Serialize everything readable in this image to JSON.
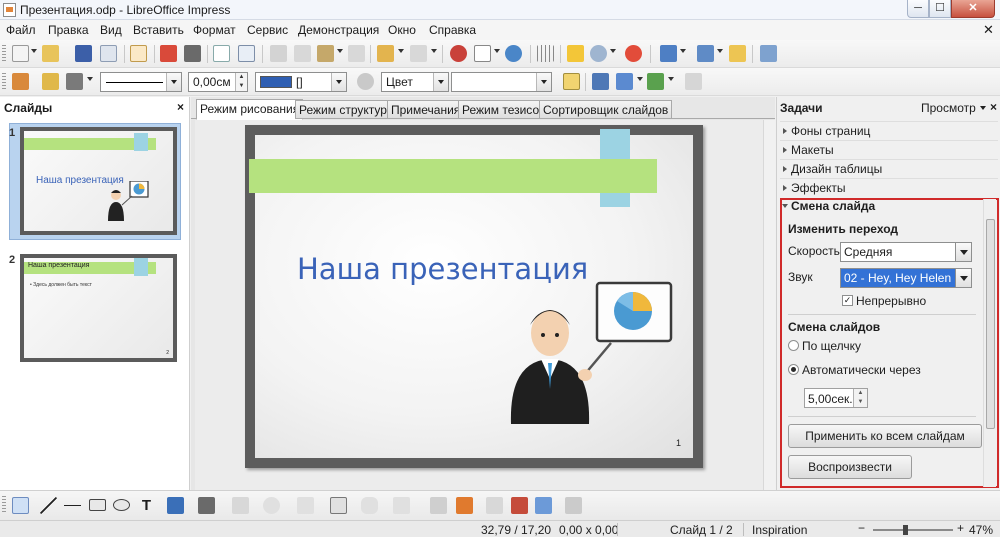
{
  "window": {
    "title": "Презентация.odp - LibreOffice Impress",
    "min": "─",
    "max": "☐",
    "close": "✕"
  },
  "menu": [
    "Файл",
    "Правка",
    "Вид",
    "Вставить",
    "Формат",
    "Сервис",
    "Демонстрация",
    "Окно",
    "Справка"
  ],
  "format_bar": {
    "line_width": "0,00см",
    "area_style": "Цвет",
    "line_color_swatch": "#2f5fb3",
    "line_color_name": "[]"
  },
  "slides_panel": {
    "title": "Слайды",
    "slides": [
      {
        "number": "1",
        "title": "Наша презентация",
        "selected": true
      },
      {
        "number": "2",
        "title": "Наша презентация",
        "bullet": "• Здесь должен быть текст",
        "selected": false
      }
    ]
  },
  "view_tabs": [
    "Режим рисования",
    "Режим структуры",
    "Примечания",
    "Режим тезисов",
    "Сортировщик слайдов"
  ],
  "slide": {
    "title": "Наша презентация",
    "number": "1"
  },
  "tasks": {
    "title": "Задачи",
    "view_menu": "Просмотр",
    "sections": [
      "Фоны страниц",
      "Макеты",
      "Дизайн таблицы",
      "Эффекты",
      "Смена слайда"
    ],
    "transition": {
      "modify_header": "Изменить переход",
      "speed_label": "Скорость",
      "speed_value": "Средняя",
      "sound_label": "Звук",
      "sound_value": "02 - Hey, Hey Helen",
      "loop_label": "Непрерывно",
      "loop_checked": true,
      "advance_header": "Смена слайдов",
      "on_click": "По щелчку",
      "auto_after": "Автоматически через",
      "auto_selected": true,
      "delay": "5,00сек.",
      "apply_all": "Применить ко всем слайдам",
      "play": "Воспроизвести"
    }
  },
  "status": {
    "position": "32,79 / 17,20",
    "size": "0,00 x 0,00",
    "slide": "Слайд 1 / 2",
    "master": "Inspiration",
    "zoom": "47%",
    "zoom_level": 0.47
  },
  "colors": {
    "accent_green": "#b5e27f",
    "accent_cyan": "#9cd3e3",
    "title_blue": "#3a63b8",
    "highlight_red": "#d02a2a",
    "selection_blue": "#3372d6"
  }
}
